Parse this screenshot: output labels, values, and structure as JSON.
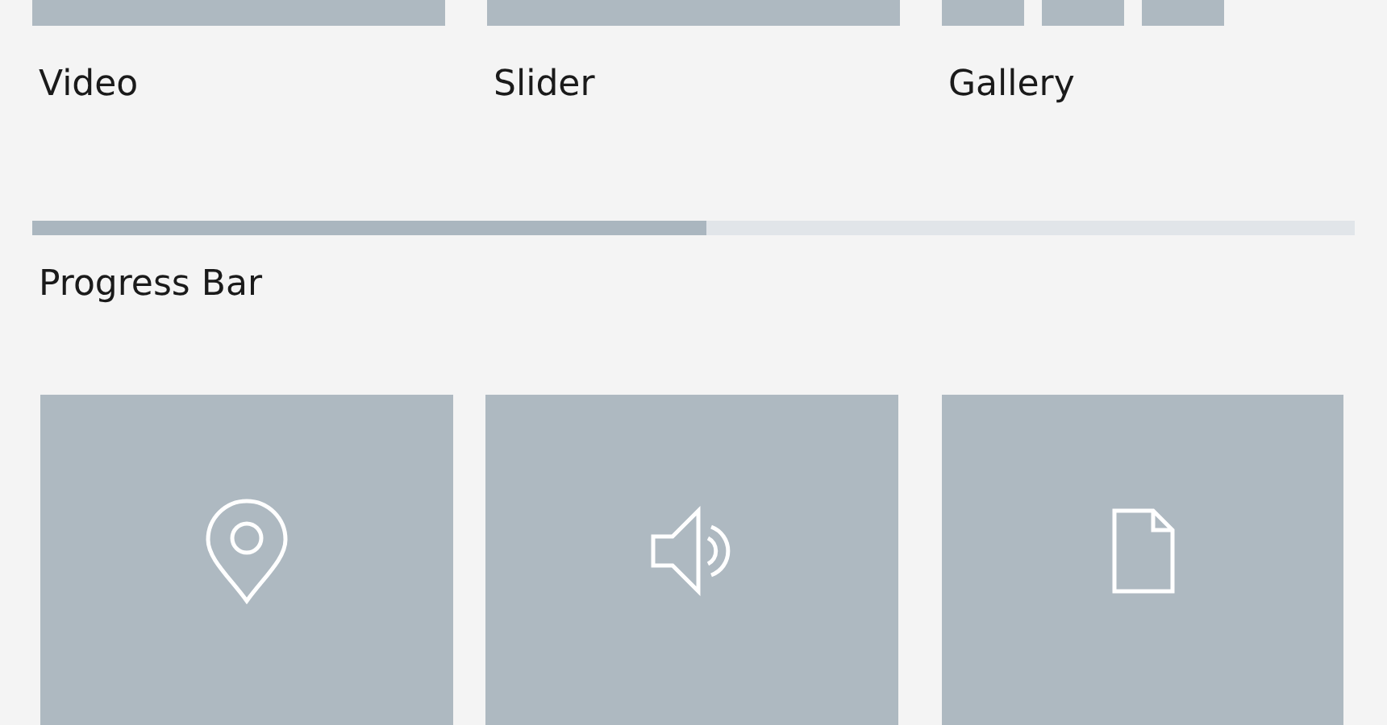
{
  "widgets": [
    {
      "kind": "video",
      "label": "Video"
    },
    {
      "kind": "slider",
      "label": "Slider"
    },
    {
      "kind": "gallery",
      "label": "Gallery"
    }
  ],
  "progress": {
    "label": "Progress Bar",
    "level": 0.51
  },
  "tiles": [
    {
      "kind": "location"
    },
    {
      "kind": "sound"
    },
    {
      "kind": "file"
    }
  ]
}
